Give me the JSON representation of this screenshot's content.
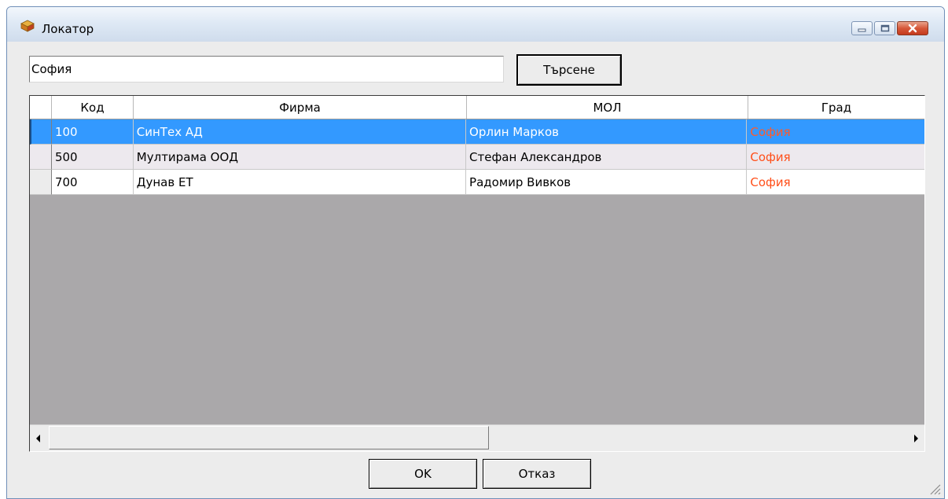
{
  "window": {
    "title": "Локатор",
    "buttons": [
      "minimize-icon",
      "maximize-icon",
      "close-icon"
    ]
  },
  "search": {
    "value": "София",
    "button_label": "Търсене"
  },
  "grid": {
    "columns": [
      "Код",
      "Фирма",
      "МОЛ",
      "Град"
    ],
    "rows": [
      {
        "code": "100",
        "firm": "СинТех АД",
        "mol": "Орлин Марков",
        "city": "София",
        "selected": true
      },
      {
        "code": "500",
        "firm": "Мултирама ООД",
        "mol": "Стефан Александров",
        "city": "София"
      },
      {
        "code": "700",
        "firm": "Дунав ЕТ",
        "mol": "Радомир Вивков",
        "city": "София"
      }
    ]
  },
  "footer": {
    "ok_label": "OK",
    "cancel_label": "Отказ"
  },
  "colors": {
    "selection": "#3399ff",
    "city_text": "#ff4f1a",
    "grid_background": "#aaa8aa"
  }
}
